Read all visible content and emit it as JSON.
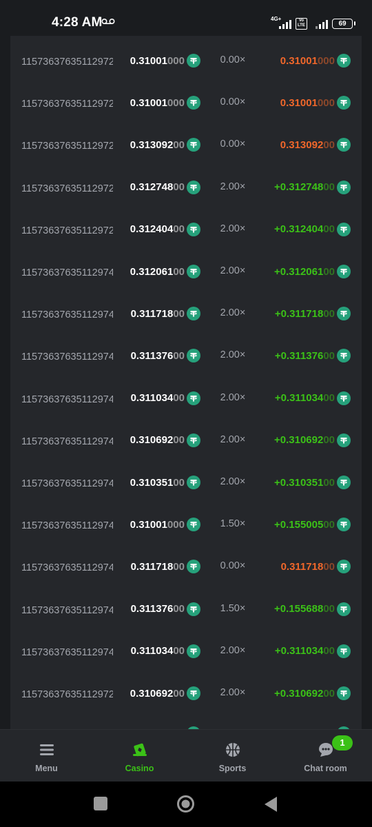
{
  "status_bar": {
    "time": "4:28 AM",
    "network_label": "4G+",
    "volte_label_top": "Vo",
    "volte_label_bottom": "LTE",
    "battery": "69"
  },
  "colors": {
    "win": "#3bc117",
    "loss": "#f0672a",
    "coin": "#26a17b",
    "muted": "#a3a6ad"
  },
  "currency_icon": "tether-icon",
  "bets": [
    {
      "id": "11573637635112972",
      "amount_main": "0.31001",
      "amount_dim": "000",
      "multiplier": "0.00×",
      "payout_main": "0.31001",
      "payout_dim": "000",
      "result": "loss"
    },
    {
      "id": "11573637635112972",
      "amount_main": "0.31001",
      "amount_dim": "000",
      "multiplier": "0.00×",
      "payout_main": "0.31001",
      "payout_dim": "000",
      "result": "loss"
    },
    {
      "id": "11573637635112972",
      "amount_main": "0.313092",
      "amount_dim": "00",
      "multiplier": "0.00×",
      "payout_main": "0.313092",
      "payout_dim": "00",
      "result": "loss"
    },
    {
      "id": "11573637635112972",
      "amount_main": "0.312748",
      "amount_dim": "00",
      "multiplier": "2.00×",
      "payout_main": "+0.312748",
      "payout_dim": "00",
      "result": "win"
    },
    {
      "id": "11573637635112972",
      "amount_main": "0.312404",
      "amount_dim": "00",
      "multiplier": "2.00×",
      "payout_main": "+0.312404",
      "payout_dim": "00",
      "result": "win"
    },
    {
      "id": "11573637635112974",
      "amount_main": "0.312061",
      "amount_dim": "00",
      "multiplier": "2.00×",
      "payout_main": "+0.312061",
      "payout_dim": "00",
      "result": "win"
    },
    {
      "id": "11573637635112974",
      "amount_main": "0.311718",
      "amount_dim": "00",
      "multiplier": "2.00×",
      "payout_main": "+0.311718",
      "payout_dim": "00",
      "result": "win"
    },
    {
      "id": "11573637635112974",
      "amount_main": "0.311376",
      "amount_dim": "00",
      "multiplier": "2.00×",
      "payout_main": "+0.311376",
      "payout_dim": "00",
      "result": "win"
    },
    {
      "id": "11573637635112974",
      "amount_main": "0.311034",
      "amount_dim": "00",
      "multiplier": "2.00×",
      "payout_main": "+0.311034",
      "payout_dim": "00",
      "result": "win"
    },
    {
      "id": "11573637635112974",
      "amount_main": "0.310692",
      "amount_dim": "00",
      "multiplier": "2.00×",
      "payout_main": "+0.310692",
      "payout_dim": "00",
      "result": "win"
    },
    {
      "id": "11573637635112974",
      "amount_main": "0.310351",
      "amount_dim": "00",
      "multiplier": "2.00×",
      "payout_main": "+0.310351",
      "payout_dim": "00",
      "result": "win"
    },
    {
      "id": "11573637635112974",
      "amount_main": "0.31001",
      "amount_dim": "000",
      "multiplier": "1.50×",
      "payout_main": "+0.155005",
      "payout_dim": "00",
      "result": "win"
    },
    {
      "id": "11573637635112974",
      "amount_main": "0.311718",
      "amount_dim": "00",
      "multiplier": "0.00×",
      "payout_main": "0.311718",
      "payout_dim": "00",
      "result": "loss"
    },
    {
      "id": "11573637635112974",
      "amount_main": "0.311376",
      "amount_dim": "00",
      "multiplier": "1.50×",
      "payout_main": "+0.155688",
      "payout_dim": "00",
      "result": "win"
    },
    {
      "id": "11573637635112974",
      "amount_main": "0.311034",
      "amount_dim": "00",
      "multiplier": "2.00×",
      "payout_main": "+0.311034",
      "payout_dim": "00",
      "result": "win"
    },
    {
      "id": "11573637635112972",
      "amount_main": "0.310692",
      "amount_dim": "00",
      "multiplier": "2.00×",
      "payout_main": "+0.310692",
      "payout_dim": "00",
      "result": "win"
    }
  ],
  "bottom_nav": {
    "items": [
      {
        "label": "Menu",
        "icon": "menu-icon"
      },
      {
        "label": "Casino",
        "icon": "casino-icon"
      },
      {
        "label": "Sports",
        "icon": "basketball-icon"
      },
      {
        "label": "Chat room",
        "icon": "chat-icon"
      }
    ],
    "active": "Casino",
    "chat_badge": "1"
  },
  "system_nav": {
    "buttons": [
      "recents-button",
      "home-button",
      "back-button"
    ]
  }
}
